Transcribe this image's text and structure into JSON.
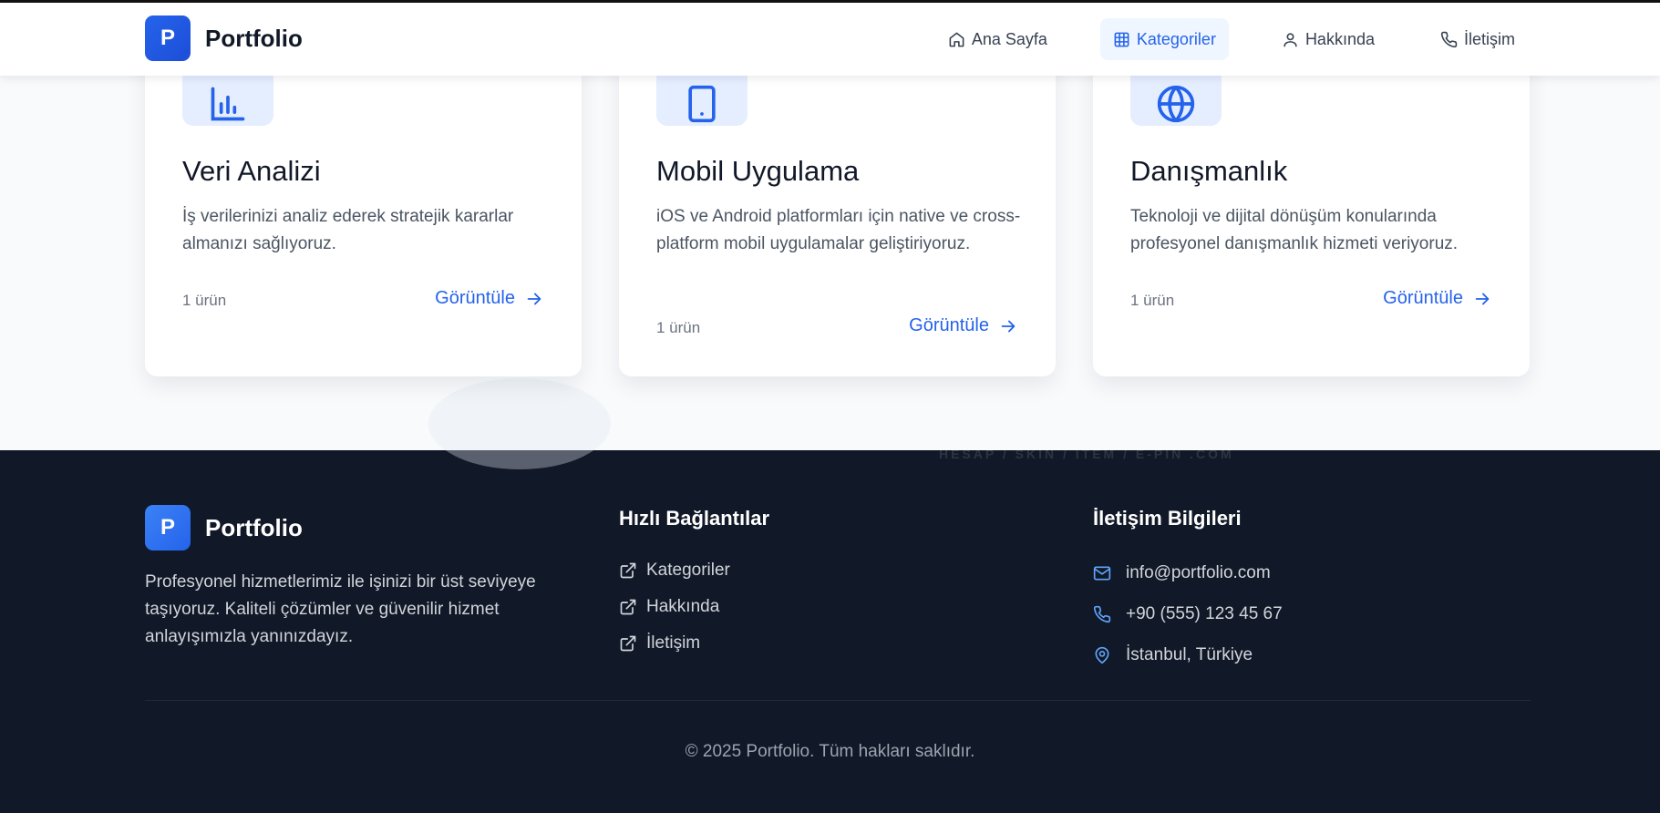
{
  "header": {
    "logo_letter": "P",
    "brand": "Portfolio",
    "nav": [
      {
        "label": "Ana Sayfa",
        "icon": "home-icon"
      },
      {
        "label": "Kategoriler",
        "icon": "grid-icon",
        "active": true
      },
      {
        "label": "Hakkında",
        "icon": "user-icon"
      },
      {
        "label": "İletişim",
        "icon": "phone-icon"
      }
    ]
  },
  "cards": [
    {
      "icon": "bar-chart-icon",
      "title": "Veri Analizi",
      "description": "İş verilerinizi analiz ederek stratejik kararlar almanızı sağlıyoruz.",
      "count": "1 ürün",
      "link": "Görüntüle"
    },
    {
      "icon": "tablet-icon",
      "title": "Mobil Uygulama",
      "description": "iOS ve Android platformları için native ve cross-platform mobil uygulamalar geliştiriyoruz.",
      "count": "1 ürün",
      "link": "Görüntüle"
    },
    {
      "icon": "globe-icon",
      "title": "Danışmanlık",
      "description": "Teknoloji ve dijital dönüşüm konularında profesyonel danışmanlık hizmeti veriyoruz.",
      "count": "1 ürün",
      "link": "Görüntüle"
    }
  ],
  "watermark": "HESAP / SKIN / ITEM / E-PIN .COM",
  "footer": {
    "logo_letter": "P",
    "brand": "Portfolio",
    "description": "Profesyonel hizmetlerimiz ile işinizi bir üst seviyeye taşıyoruz. Kaliteli çözümler ve güvenilir hizmet anlayışımızla yanınızdayız.",
    "quick_links_title": "Hızlı Bağlantılar",
    "quick_links": [
      "Kategoriler",
      "Hakkında",
      "İletişim"
    ],
    "contact_title": "İletişim Bilgileri",
    "contact": [
      {
        "icon": "mail-icon",
        "text": "info@portfolio.com"
      },
      {
        "icon": "phone-icon",
        "text": "+90 (555) 123 45 67"
      },
      {
        "icon": "map-pin-icon",
        "text": "İstanbul, Türkiye"
      }
    ],
    "copyright": "© 2025 Portfolio. Tüm hakları saklıdır."
  },
  "colors": {
    "accent": "#2563eb",
    "footer_bg": "#111827",
    "page_bg": "#f8fafc"
  }
}
